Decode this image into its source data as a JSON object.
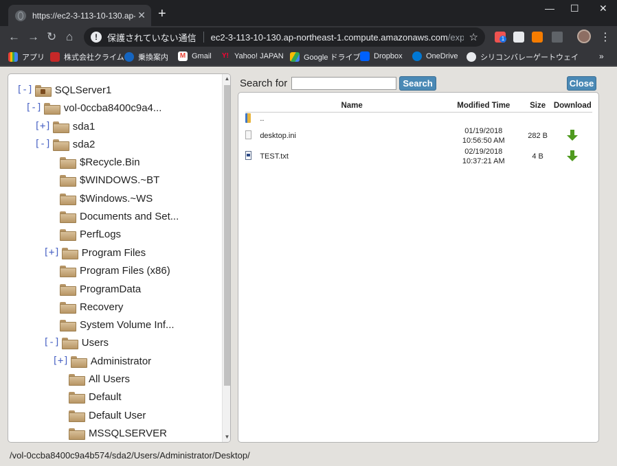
{
  "browser": {
    "tab_title": "https://ec2-3-113-10-130.ap-nor",
    "tab_close": "✕",
    "new_tab": "+",
    "security_label": "保護されていない通信",
    "url_host": "ec2-3-113-10-130.ap-northeast-1.compute.amazonaws.com",
    "url_path": "/explore/b...",
    "window_controls": {
      "minimize": "—",
      "maximize": "☐",
      "close": "✕"
    },
    "nav": {
      "back": "←",
      "forward": "→",
      "reload": "↻",
      "home": "⌂"
    },
    "star": "☆",
    "menu": "⋮",
    "ext_badge": "1",
    "bookmarks": [
      {
        "label": "アプリ",
        "icon": "apps-grid-icon",
        "color": "#e8eaed"
      },
      {
        "label": "株式会社クライム",
        "icon": "climb-logo-icon",
        "color": "#c62828"
      },
      {
        "label": "乗換案内",
        "icon": "norikae-icon",
        "color": "#1565c0"
      },
      {
        "label": "Gmail",
        "icon": "gmail-icon",
        "color": "#ea4335"
      },
      {
        "label": "Yahoo! JAPAN",
        "icon": "yahoo-icon",
        "color": "#ff0033"
      },
      {
        "label": "Google ドライブ",
        "icon": "google-drive-icon",
        "color": "#fbbc04"
      },
      {
        "label": "Dropbox",
        "icon": "dropbox-icon",
        "color": "#0061ff"
      },
      {
        "label": "OneDrive",
        "icon": "onedrive-icon",
        "color": "#0078d4"
      },
      {
        "label": "シリコンバレーゲートウェイ",
        "icon": "globe-icon",
        "color": "#e8eaed"
      }
    ],
    "bookmarks_more": "»"
  },
  "tree": {
    "nodes": [
      {
        "toggle": "[-]",
        "label": "SQLServer1"
      },
      {
        "toggle": "[-]",
        "label": "vol-0ccba8400c9a4..."
      },
      {
        "toggle": "[+]",
        "label": "sda1"
      },
      {
        "toggle": "[-]",
        "label": "sda2"
      },
      {
        "toggle": "",
        "label": "$Recycle.Bin"
      },
      {
        "toggle": "",
        "label": "$WINDOWS.~BT"
      },
      {
        "toggle": "",
        "label": "$Windows.~WS"
      },
      {
        "toggle": "",
        "label": "Documents and Set..."
      },
      {
        "toggle": "",
        "label": "PerfLogs"
      },
      {
        "toggle": "[+]",
        "label": "Program Files"
      },
      {
        "toggle": "",
        "label": "Program Files (x86)"
      },
      {
        "toggle": "",
        "label": "ProgramData"
      },
      {
        "toggle": "",
        "label": "Recovery"
      },
      {
        "toggle": "",
        "label": "System Volume Inf..."
      },
      {
        "toggle": "[-]",
        "label": "Users"
      },
      {
        "toggle": "[+]",
        "label": "Administrator"
      },
      {
        "toggle": "",
        "label": "All Users"
      },
      {
        "toggle": "",
        "label": "Default"
      },
      {
        "toggle": "",
        "label": "Default User"
      },
      {
        "toggle": "",
        "label": "MSSQLSERVER"
      }
    ],
    "scroll_up": "▲",
    "scroll_down": "▼"
  },
  "search": {
    "label": "Search for",
    "value": "",
    "button": "Search",
    "close_button": "Close"
  },
  "files": {
    "columns": {
      "name": "Name",
      "modified": "Modified Time",
      "size": "Size",
      "download": "Download"
    },
    "parent": "..",
    "rows": [
      {
        "name": "desktop.ini",
        "date": "01/19/2018",
        "time": "10:56:50 AM",
        "size": "282 B"
      },
      {
        "name": "TEST.txt",
        "date": "02/19/2018",
        "time": "10:37:21 AM",
        "size": "4 B"
      }
    ]
  },
  "status": {
    "path": "/vol-0ccba8400c9a4b574/sda2/Users/Administrator/Desktop/"
  }
}
